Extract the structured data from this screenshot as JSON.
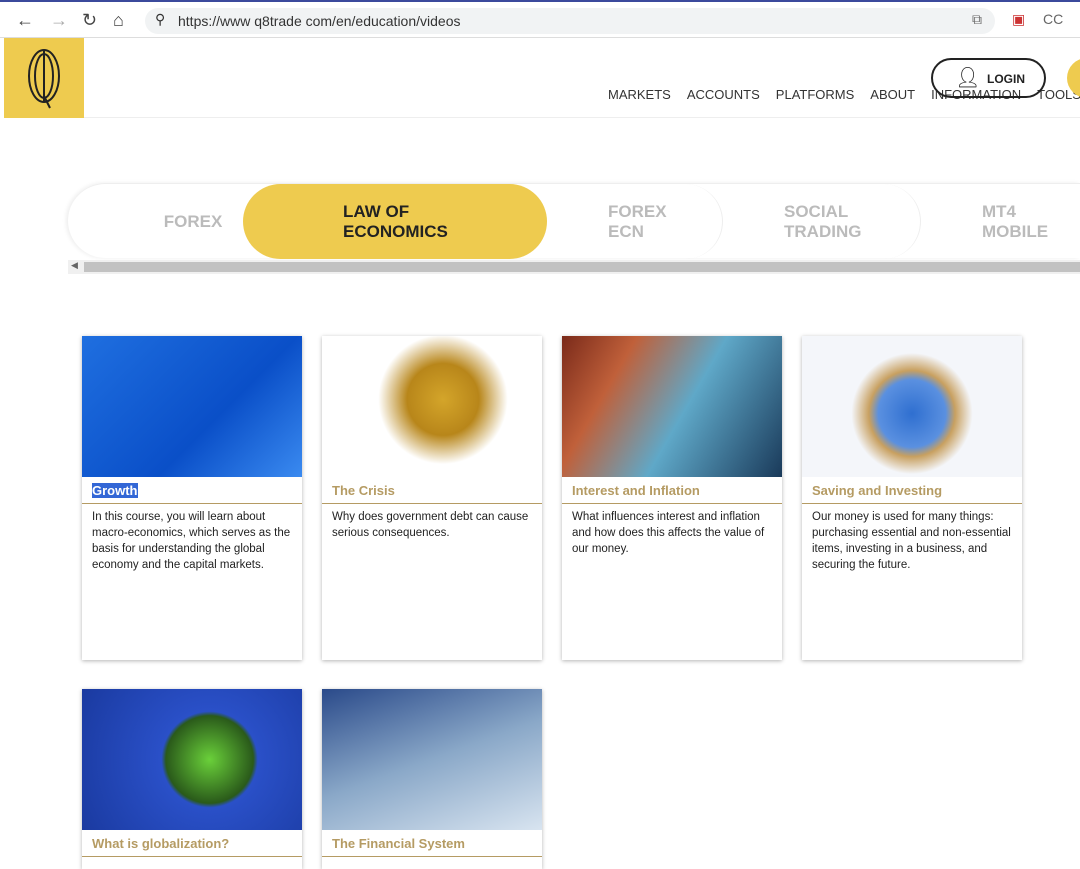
{
  "browser": {
    "url": "https://www q8trade com/en/education/videos",
    "ext_cc": "CC"
  },
  "header": {
    "login": "LOGIN",
    "nav": [
      "MARKETS",
      "ACCOUNTS",
      "PLATFORMS",
      "ABOUT",
      "INFORMATION",
      "TOOLS AN"
    ]
  },
  "tabs": [
    {
      "label": "FOREX"
    },
    {
      "label": "LAW OF ECONOMICS",
      "active": true
    },
    {
      "label": "FOREX ECN"
    },
    {
      "label": "SOCIAL TRADING"
    },
    {
      "label": "MT4 MOBILE"
    }
  ],
  "cards": [
    {
      "title": "Growth",
      "desc": "In this course, you will learn about macro-economics, which serves as the basis for understanding the global economy and the capital markets."
    },
    {
      "title": "The Crisis",
      "desc": "Why does government debt can cause serious consequences."
    },
    {
      "title": "Interest and Inflation",
      "desc": "What influences interest and inflation and how does this affects the value of our money."
    },
    {
      "title": "Saving and Investing",
      "desc": "Our money is used for many things: purchasing essential and non-essential items, investing in a business, and securing the future."
    },
    {
      "title": "What is globalization?",
      "desc": ""
    },
    {
      "title": "The Financial System",
      "desc": ""
    }
  ]
}
